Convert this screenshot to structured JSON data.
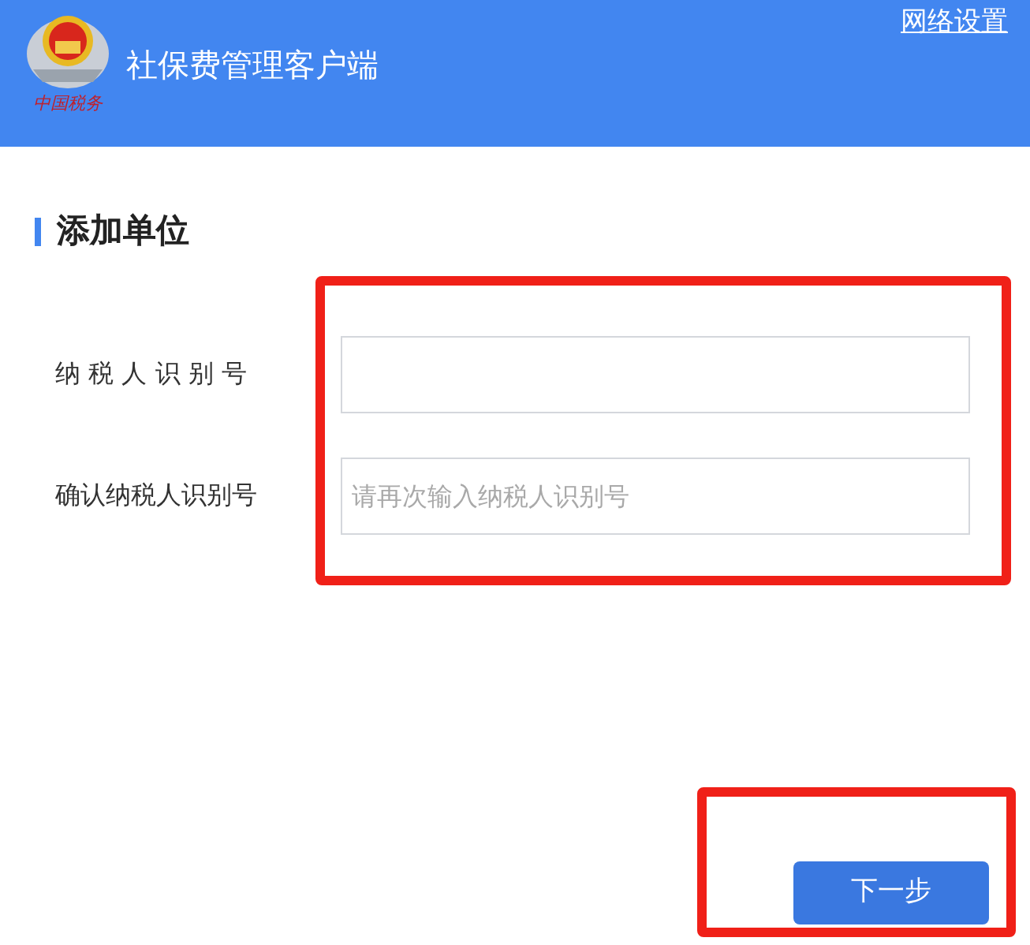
{
  "header": {
    "logo_text": "中国税务",
    "title": "社保费管理客户端",
    "network_link": "网络设置"
  },
  "section": {
    "title": "添加单位"
  },
  "fields": [
    {
      "label": "纳 税 人 识 别 号"
    },
    {
      "label": "确认纳税人识别号",
      "placeholder": "请再次输入纳税人识别号"
    }
  ],
  "buttons": [
    "下一步"
  ]
}
